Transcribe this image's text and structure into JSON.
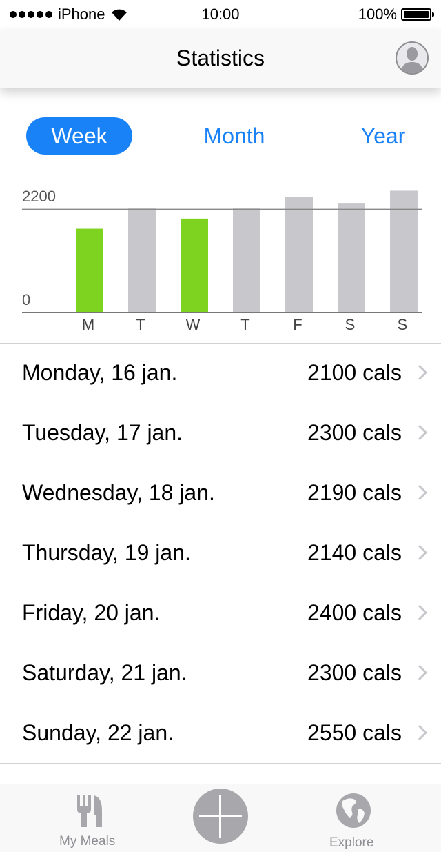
{
  "status": {
    "carrier": "iPhone",
    "time": "10:00",
    "battery": "100%"
  },
  "nav": {
    "title": "Statistics",
    "profile_icon": "person-icon"
  },
  "segments": {
    "week": "Week",
    "month": "Month",
    "year": "Year",
    "selected": "Week"
  },
  "chart_data": {
    "type": "bar",
    "categories": [
      "M",
      "T",
      "W",
      "T",
      "F",
      "S",
      "S"
    ],
    "values": [
      2100,
      2300,
      2190,
      2140,
      2400,
      2300,
      2550
    ],
    "display_values": [
      1640,
      2040,
      1840,
      2040,
      2260,
      2150,
      2390
    ],
    "goal": 2200,
    "ylim": [
      0,
      2750
    ],
    "y_tick_labels": [
      "2200",
      "0"
    ],
    "colors": {
      "under_goal": "#7ed321",
      "over_goal": "#c7c7cc",
      "goal_line": "#888888"
    },
    "under_goal_flags": [
      true,
      false,
      true,
      false,
      false,
      false,
      false
    ]
  },
  "days": [
    {
      "day": "Monday, 16 jan.",
      "cals": "2100 cals"
    },
    {
      "day": "Tuesday, 17 jan.",
      "cals": "2300 cals"
    },
    {
      "day": "Wednesday, 18 jan.",
      "cals": "2190 cals"
    },
    {
      "day": "Thursday, 19 jan.",
      "cals": "2140 cals"
    },
    {
      "day": "Friday, 20 jan.",
      "cals": "2400 cals"
    },
    {
      "day": "Saturday, 21 jan.",
      "cals": "2300 cals"
    },
    {
      "day": "Sunday, 22 jan.",
      "cals": "2550 cals"
    }
  ],
  "tabbar": {
    "my_meals": "My Meals",
    "explore": "Explore",
    "add_icon": "plus-icon"
  },
  "colors": {
    "accent": "#1a82f7",
    "gray": "#8e8e93"
  }
}
